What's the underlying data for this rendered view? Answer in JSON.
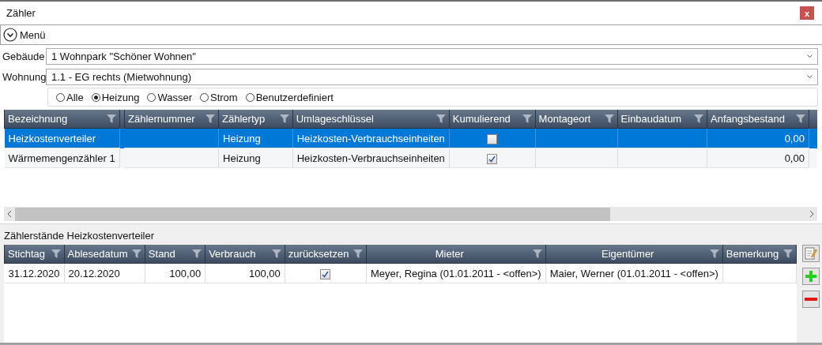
{
  "window": {
    "title": "Zähler",
    "close": "x"
  },
  "menu": {
    "label": "Menü"
  },
  "fields": [
    {
      "label": "Gebäude",
      "value": "1 Wohnpark \"Schöner Wohnen\""
    },
    {
      "label": "Wohnung",
      "value": "1.1 - EG rechts (Mietwohnung)"
    }
  ],
  "filters": [
    {
      "label": "Alle",
      "selected": false
    },
    {
      "label": "Heizung",
      "selected": true
    },
    {
      "label": "Wasser",
      "selected": false
    },
    {
      "label": "Strom",
      "selected": false
    },
    {
      "label": "Benutzerdefiniert",
      "selected": false
    }
  ],
  "meter_grid": {
    "columns": [
      {
        "label": "Bezeichnung",
        "kind": "text"
      },
      {
        "label": "Zählernummer",
        "kind": "text"
      },
      {
        "label": "Zählertyp",
        "kind": "text"
      },
      {
        "label": "Umlageschlüssel",
        "kind": "text"
      },
      {
        "label": "Kumulierend",
        "kind": "check"
      },
      {
        "label": "Montageort",
        "kind": "text"
      },
      {
        "label": "Einbaudatum",
        "kind": "text"
      },
      {
        "label": "Anfangsbestand",
        "kind": "number"
      }
    ],
    "rows": [
      {
        "selected": true,
        "cells": [
          "Heizkostenverteiler",
          null,
          "Heizung",
          "Heizkosten-Verbrauchseinheiten",
          {
            "checked": false
          },
          null,
          null,
          "0,00"
        ]
      },
      {
        "selected": false,
        "cells": [
          "Wärmemengenzähler 1",
          null,
          "Heizung",
          "Heizkosten-Verbrauchseinheiten",
          {
            "checked": true
          },
          null,
          null,
          "0,00"
        ]
      }
    ]
  },
  "readings": {
    "title": "Zählerstände Heizkostenverteiler",
    "columns": [
      {
        "label": "Stichtag",
        "kind": "text"
      },
      {
        "label": "Ablesedatum",
        "kind": "text"
      },
      {
        "label": "Stand",
        "kind": "number"
      },
      {
        "label": "Verbrauch",
        "kind": "number"
      },
      {
        "label": "zurücksetzen",
        "kind": "check"
      },
      {
        "label": "Mieter",
        "kind": "person"
      },
      {
        "label": "Eigentümer",
        "kind": "person"
      },
      {
        "label": "Bemerkung",
        "kind": "text"
      }
    ],
    "rows": [
      {
        "selected": false,
        "cells": [
          "31.12.2020",
          "20.12.2020",
          "100,00",
          "100,00",
          {
            "checked": true
          },
          "Meyer, Regina (01.01.2011 - <offen>)",
          "Maier, Werner (01.01.2011 - <offen>)",
          null
        ]
      }
    ]
  }
}
